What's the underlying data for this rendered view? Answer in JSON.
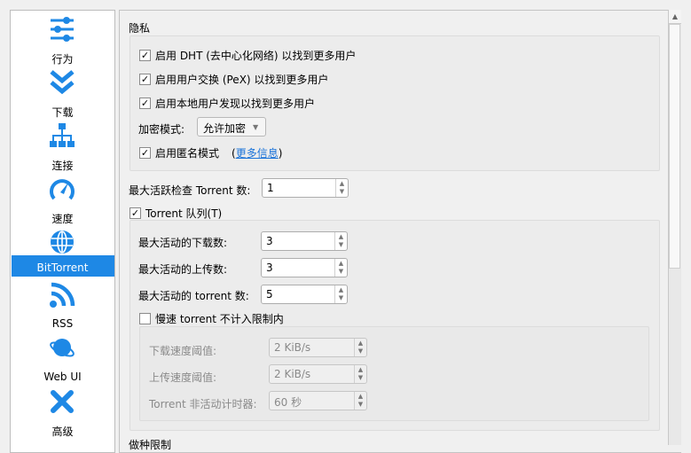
{
  "sidebar": {
    "items": [
      {
        "label": "行为",
        "icon": "sliders-icon"
      },
      {
        "label": "下载",
        "icon": "double-chevron-down-icon"
      },
      {
        "label": "连接",
        "icon": "network-icon"
      },
      {
        "label": "速度",
        "icon": "speedometer-icon"
      },
      {
        "label": "BitTorrent",
        "icon": "globe-icon",
        "selected": true
      },
      {
        "label": "RSS",
        "icon": "rss-icon"
      },
      {
        "label": "Web UI",
        "icon": "planet-icon"
      },
      {
        "label": "高级",
        "icon": "tools-icon"
      }
    ]
  },
  "privacy": {
    "title": "隐私",
    "dht": "启用 DHT (去中心化网络) 以找到更多用户",
    "pex": "启用用户交换 (PeX) 以找到更多用户",
    "lsd": "启用本地用户发现以找到更多用户",
    "encryption_label": "加密模式:",
    "encryption_value": "允许加密",
    "anon": "启用匿名模式",
    "anon_open": "(",
    "more_info": "更多信息",
    "anon_close": ")"
  },
  "max_checking": {
    "label": "最大活跃检查 Torrent 数:",
    "value": "1"
  },
  "queue": {
    "label": "Torrent 队列(T)",
    "max_downloads": {
      "label": "最大活动的下载数:",
      "value": "3"
    },
    "max_uploads": {
      "label": "最大活动的上传数:",
      "value": "3"
    },
    "max_torrents": {
      "label": "最大活动的 torrent 数:",
      "value": "5"
    },
    "slow": {
      "label": "慢速 torrent 不计入限制内",
      "dl": {
        "label": "下载速度阈值:",
        "value": "2 KiB/s"
      },
      "ul": {
        "label": "上传速度阈值:",
        "value": "2 KiB/s"
      },
      "timer": {
        "label": "Torrent 非活动计时器:",
        "value": "60 秒"
      }
    }
  },
  "seeding": {
    "title": "做种限制"
  },
  "colors": {
    "accent": "#1e88e5"
  }
}
